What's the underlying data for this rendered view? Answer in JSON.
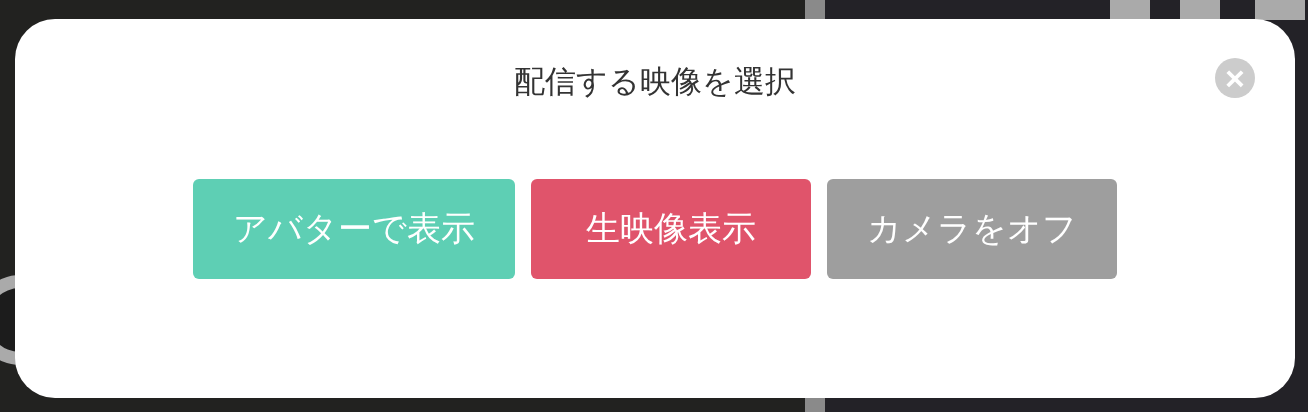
{
  "dialog": {
    "title": "配信する映像を選択",
    "close": "×",
    "buttons": [
      {
        "label": "アバターで表示",
        "color": "#5ecfb4"
      },
      {
        "label": "生映像表示",
        "color": "#e0546b"
      },
      {
        "label": "カメラをオフ",
        "color": "#9e9e9e"
      }
    ]
  }
}
